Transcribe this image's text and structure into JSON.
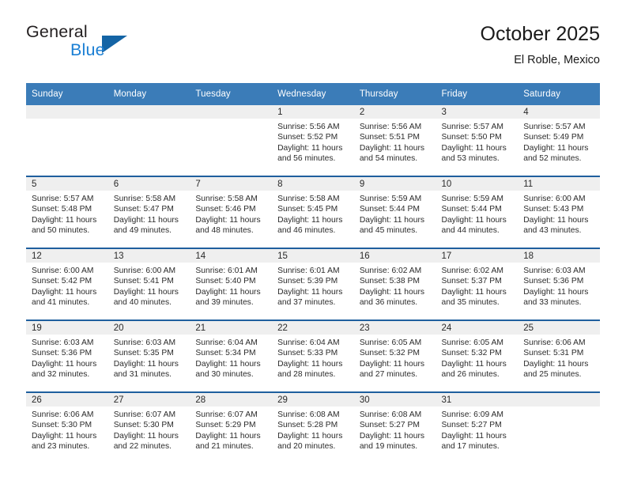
{
  "brand": {
    "name_top": "General",
    "name_bottom": "Blue",
    "accent_color": "#1464a5",
    "blue_text_color": "#1b7fd4"
  },
  "header": {
    "title": "October 2025",
    "subtitle": "El Roble, Mexico"
  },
  "theme": {
    "header_row_bg": "#3b7cb8",
    "week_separator": "#1f5f9e",
    "daynum_strip_bg": "#efefef"
  },
  "weekday_headers": [
    "Sunday",
    "Monday",
    "Tuesday",
    "Wednesday",
    "Thursday",
    "Friday",
    "Saturday"
  ],
  "labels": {
    "sunrise_prefix": "Sunrise:",
    "sunset_prefix": "Sunset:",
    "daylight_prefix": "Daylight:"
  },
  "weeks": [
    [
      {
        "day": "",
        "empty": true
      },
      {
        "day": "",
        "empty": true
      },
      {
        "day": "",
        "empty": true
      },
      {
        "day": "1",
        "sunrise": "Sunrise: 5:56 AM",
        "sunset": "Sunset: 5:52 PM",
        "daylight": "Daylight: 11 hours and 56 minutes."
      },
      {
        "day": "2",
        "sunrise": "Sunrise: 5:56 AM",
        "sunset": "Sunset: 5:51 PM",
        "daylight": "Daylight: 11 hours and 54 minutes."
      },
      {
        "day": "3",
        "sunrise": "Sunrise: 5:57 AM",
        "sunset": "Sunset: 5:50 PM",
        "daylight": "Daylight: 11 hours and 53 minutes."
      },
      {
        "day": "4",
        "sunrise": "Sunrise: 5:57 AM",
        "sunset": "Sunset: 5:49 PM",
        "daylight": "Daylight: 11 hours and 52 minutes."
      }
    ],
    [
      {
        "day": "5",
        "sunrise": "Sunrise: 5:57 AM",
        "sunset": "Sunset: 5:48 PM",
        "daylight": "Daylight: 11 hours and 50 minutes."
      },
      {
        "day": "6",
        "sunrise": "Sunrise: 5:58 AM",
        "sunset": "Sunset: 5:47 PM",
        "daylight": "Daylight: 11 hours and 49 minutes."
      },
      {
        "day": "7",
        "sunrise": "Sunrise: 5:58 AM",
        "sunset": "Sunset: 5:46 PM",
        "daylight": "Daylight: 11 hours and 48 minutes."
      },
      {
        "day": "8",
        "sunrise": "Sunrise: 5:58 AM",
        "sunset": "Sunset: 5:45 PM",
        "daylight": "Daylight: 11 hours and 46 minutes."
      },
      {
        "day": "9",
        "sunrise": "Sunrise: 5:59 AM",
        "sunset": "Sunset: 5:44 PM",
        "daylight": "Daylight: 11 hours and 45 minutes."
      },
      {
        "day": "10",
        "sunrise": "Sunrise: 5:59 AM",
        "sunset": "Sunset: 5:44 PM",
        "daylight": "Daylight: 11 hours and 44 minutes."
      },
      {
        "day": "11",
        "sunrise": "Sunrise: 6:00 AM",
        "sunset": "Sunset: 5:43 PM",
        "daylight": "Daylight: 11 hours and 43 minutes."
      }
    ],
    [
      {
        "day": "12",
        "sunrise": "Sunrise: 6:00 AM",
        "sunset": "Sunset: 5:42 PM",
        "daylight": "Daylight: 11 hours and 41 minutes."
      },
      {
        "day": "13",
        "sunrise": "Sunrise: 6:00 AM",
        "sunset": "Sunset: 5:41 PM",
        "daylight": "Daylight: 11 hours and 40 minutes."
      },
      {
        "day": "14",
        "sunrise": "Sunrise: 6:01 AM",
        "sunset": "Sunset: 5:40 PM",
        "daylight": "Daylight: 11 hours and 39 minutes."
      },
      {
        "day": "15",
        "sunrise": "Sunrise: 6:01 AM",
        "sunset": "Sunset: 5:39 PM",
        "daylight": "Daylight: 11 hours and 37 minutes."
      },
      {
        "day": "16",
        "sunrise": "Sunrise: 6:02 AM",
        "sunset": "Sunset: 5:38 PM",
        "daylight": "Daylight: 11 hours and 36 minutes."
      },
      {
        "day": "17",
        "sunrise": "Sunrise: 6:02 AM",
        "sunset": "Sunset: 5:37 PM",
        "daylight": "Daylight: 11 hours and 35 minutes."
      },
      {
        "day": "18",
        "sunrise": "Sunrise: 6:03 AM",
        "sunset": "Sunset: 5:36 PM",
        "daylight": "Daylight: 11 hours and 33 minutes."
      }
    ],
    [
      {
        "day": "19",
        "sunrise": "Sunrise: 6:03 AM",
        "sunset": "Sunset: 5:36 PM",
        "daylight": "Daylight: 11 hours and 32 minutes."
      },
      {
        "day": "20",
        "sunrise": "Sunrise: 6:03 AM",
        "sunset": "Sunset: 5:35 PM",
        "daylight": "Daylight: 11 hours and 31 minutes."
      },
      {
        "day": "21",
        "sunrise": "Sunrise: 6:04 AM",
        "sunset": "Sunset: 5:34 PM",
        "daylight": "Daylight: 11 hours and 30 minutes."
      },
      {
        "day": "22",
        "sunrise": "Sunrise: 6:04 AM",
        "sunset": "Sunset: 5:33 PM",
        "daylight": "Daylight: 11 hours and 28 minutes."
      },
      {
        "day": "23",
        "sunrise": "Sunrise: 6:05 AM",
        "sunset": "Sunset: 5:32 PM",
        "daylight": "Daylight: 11 hours and 27 minutes."
      },
      {
        "day": "24",
        "sunrise": "Sunrise: 6:05 AM",
        "sunset": "Sunset: 5:32 PM",
        "daylight": "Daylight: 11 hours and 26 minutes."
      },
      {
        "day": "25",
        "sunrise": "Sunrise: 6:06 AM",
        "sunset": "Sunset: 5:31 PM",
        "daylight": "Daylight: 11 hours and 25 minutes."
      }
    ],
    [
      {
        "day": "26",
        "sunrise": "Sunrise: 6:06 AM",
        "sunset": "Sunset: 5:30 PM",
        "daylight": "Daylight: 11 hours and 23 minutes."
      },
      {
        "day": "27",
        "sunrise": "Sunrise: 6:07 AM",
        "sunset": "Sunset: 5:30 PM",
        "daylight": "Daylight: 11 hours and 22 minutes."
      },
      {
        "day": "28",
        "sunrise": "Sunrise: 6:07 AM",
        "sunset": "Sunset: 5:29 PM",
        "daylight": "Daylight: 11 hours and 21 minutes."
      },
      {
        "day": "29",
        "sunrise": "Sunrise: 6:08 AM",
        "sunset": "Sunset: 5:28 PM",
        "daylight": "Daylight: 11 hours and 20 minutes."
      },
      {
        "day": "30",
        "sunrise": "Sunrise: 6:08 AM",
        "sunset": "Sunset: 5:27 PM",
        "daylight": "Daylight: 11 hours and 19 minutes."
      },
      {
        "day": "31",
        "sunrise": "Sunrise: 6:09 AM",
        "sunset": "Sunset: 5:27 PM",
        "daylight": "Daylight: 11 hours and 17 minutes."
      },
      {
        "day": "",
        "empty": true
      }
    ]
  ]
}
